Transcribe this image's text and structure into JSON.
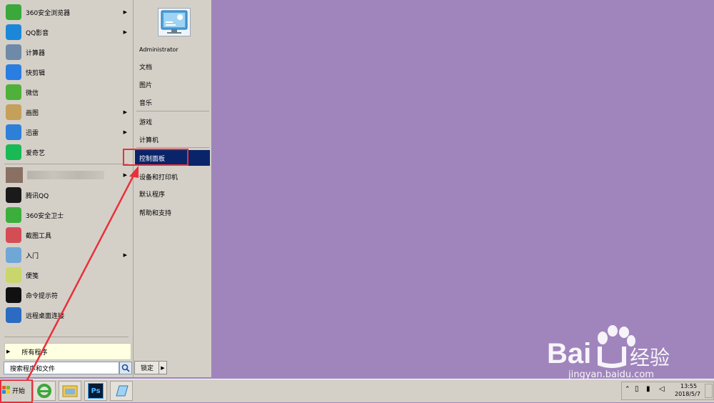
{
  "start_menu": {
    "programs": [
      {
        "label": "360安全浏览器",
        "icon": "browser-360-icon",
        "color": "#3aa83a",
        "has_submenu": true
      },
      {
        "label": "QQ影音",
        "icon": "qq-player-icon",
        "color": "#1c87d8",
        "has_submenu": true
      },
      {
        "label": "计算器",
        "icon": "calculator-icon",
        "color": "#6f8aa8",
        "has_submenu": false
      },
      {
        "label": "快剪辑",
        "icon": "video-editor-icon",
        "color": "#2a7de1",
        "has_submenu": false
      },
      {
        "label": "微信",
        "icon": "wechat-icon",
        "color": "#4fb13a",
        "has_submenu": false
      },
      {
        "label": "画图",
        "icon": "paint-icon",
        "color": "#c5a05a",
        "has_submenu": true
      },
      {
        "label": "迅雷",
        "icon": "thunder-icon",
        "color": "#2e7fd8",
        "has_submenu": true
      },
      {
        "label": "爱奇艺",
        "icon": "iqiyi-icon",
        "color": "#19b955",
        "has_submenu": false
      },
      {
        "label": "",
        "icon": "blurred-app-icon",
        "color": "#8a7063",
        "has_submenu": true
      },
      {
        "label": "腾讯QQ",
        "icon": "qq-penguin-icon",
        "color": "#1a1a1a",
        "has_submenu": false
      },
      {
        "label": "360安全卫士",
        "icon": "guard-360-icon",
        "color": "#3cae3c",
        "has_submenu": false
      },
      {
        "label": "截图工具",
        "icon": "snipping-tool-icon",
        "color": "#d44d55",
        "has_submenu": false
      },
      {
        "label": "入门",
        "icon": "getting-started-icon",
        "color": "#6fa7d6",
        "has_submenu": true
      },
      {
        "label": "便笺",
        "icon": "sticky-notes-icon",
        "color": "#c9d66b",
        "has_submenu": false
      },
      {
        "label": "命令提示符",
        "icon": "cmd-icon",
        "color": "#111111",
        "has_submenu": false
      },
      {
        "label": "远程桌面连接",
        "icon": "remote-desktop-icon",
        "color": "#2b6bc1",
        "has_submenu": false
      }
    ],
    "all_programs_label": "所有程序",
    "search_placeholder": "搜索程序和文件",
    "lock_label": "锁定",
    "right_items": [
      {
        "label": "Administrator"
      },
      {
        "label": "文档"
      },
      {
        "label": "图片"
      },
      {
        "label": "音乐"
      },
      {
        "label": "游戏"
      },
      {
        "label": "计算机"
      },
      {
        "label": "控制面板",
        "selected": true
      },
      {
        "label": "设备和打印机"
      },
      {
        "label": "默认程序"
      },
      {
        "label": "帮助和支持"
      }
    ]
  },
  "taskbar": {
    "start_label": "开始",
    "apps": [
      "ie-icon",
      "file-explorer-icon",
      "photoshop-icon",
      "notepad-icon"
    ],
    "clock_time": "13:55",
    "clock_date": "2018/5/7",
    "photoshop_text": "Ps"
  },
  "watermark": {
    "brand": "Bai",
    "brand2": "经验",
    "url": "jingyan.baidu.com"
  },
  "colors": {
    "desktop": "#a085bd",
    "selection": "#0a246a",
    "annotation": "#e8303a"
  }
}
